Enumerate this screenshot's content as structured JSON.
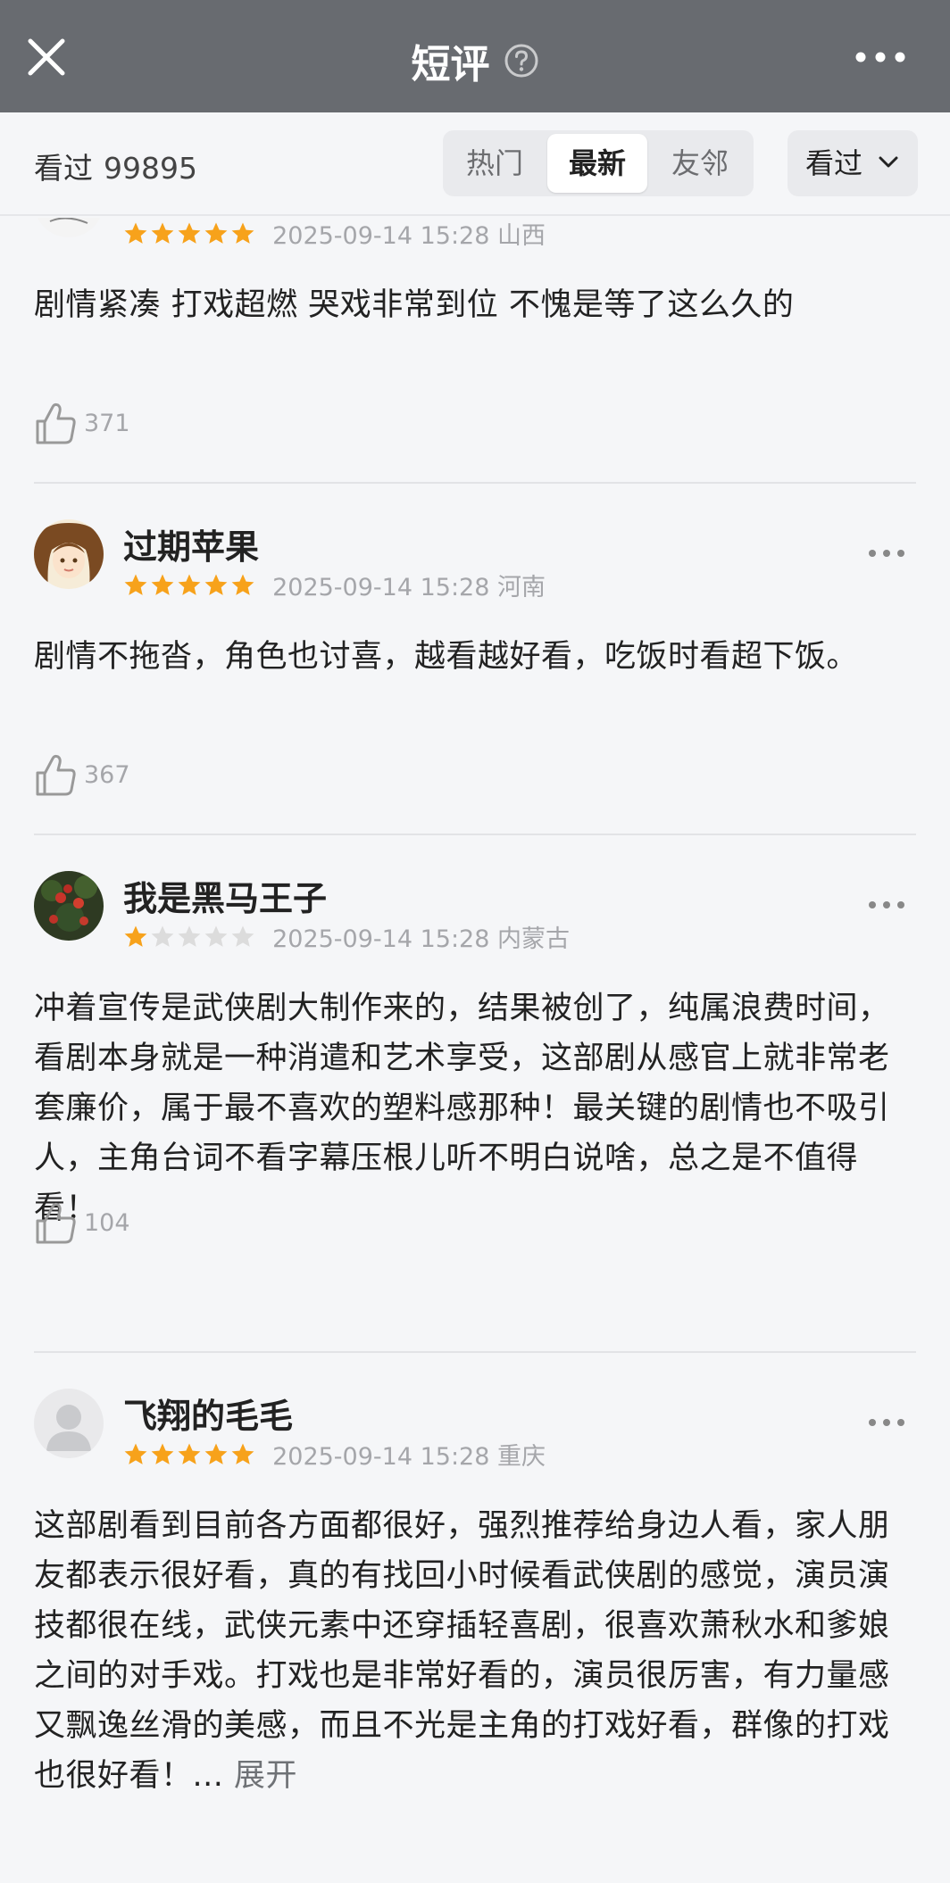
{
  "header": {
    "title": "短评"
  },
  "filter": {
    "seen_label": "看过",
    "seen_count": "99895",
    "tabs": [
      {
        "label": "热门"
      },
      {
        "label": "最新"
      },
      {
        "label": "友邻"
      }
    ],
    "selected_tab": "最新",
    "dropdown_label": "看过"
  },
  "reviews": [
    {
      "name": "",
      "rating": 5,
      "time": "2025-09-14 15:28",
      "region": "山西",
      "text": "剧情紧凑 打戏超燃 哭戏非常到位 不愧是等了这么久的",
      "likes": "371"
    },
    {
      "name": "过期苹果",
      "rating": 5,
      "time": "2025-09-14 15:28",
      "region": "河南",
      "text": "剧情不拖沓，角色也讨喜，越看越好看，吃饭时看超下饭。",
      "likes": "367"
    },
    {
      "name": "我是黑马王子",
      "rating": 1,
      "time": "2025-09-14 15:28",
      "region": "内蒙古",
      "text": "冲着宣传是武侠剧大制作来的，结果被创了，纯属浪费时间，看剧本身就是一种消遣和艺术享受，这部剧从感官上就非常老套廉价，属于最不喜欢的塑料感那种！最关键的剧情也不吸引人，主角台词不看字幕压根儿听不明白说啥，总之是不值得看！",
      "likes": "104"
    },
    {
      "name": "飞翔的毛毛",
      "rating": 5,
      "time": "2025-09-14 15:28",
      "region": "重庆",
      "text": "这部剧看到目前各方面都很好，强烈推荐给身边人看，家人朋友都表示很好看，真的有找回小时候看武侠剧的感觉，演员演技都很在线，武侠元素中还穿插轻喜剧，很喜欢萧秋水和爹娘之间的对手戏。打戏也是非常好看的，演员很厉害，有力量感又飘逸丝滑的美感，而且不光是主角的打戏好看，群像的打戏也很好看！...",
      "expand": "展开"
    }
  ],
  "colors": {
    "star": "#f7a21b",
    "star_empty": "#dcdcdc",
    "topbar": "#686b70"
  }
}
